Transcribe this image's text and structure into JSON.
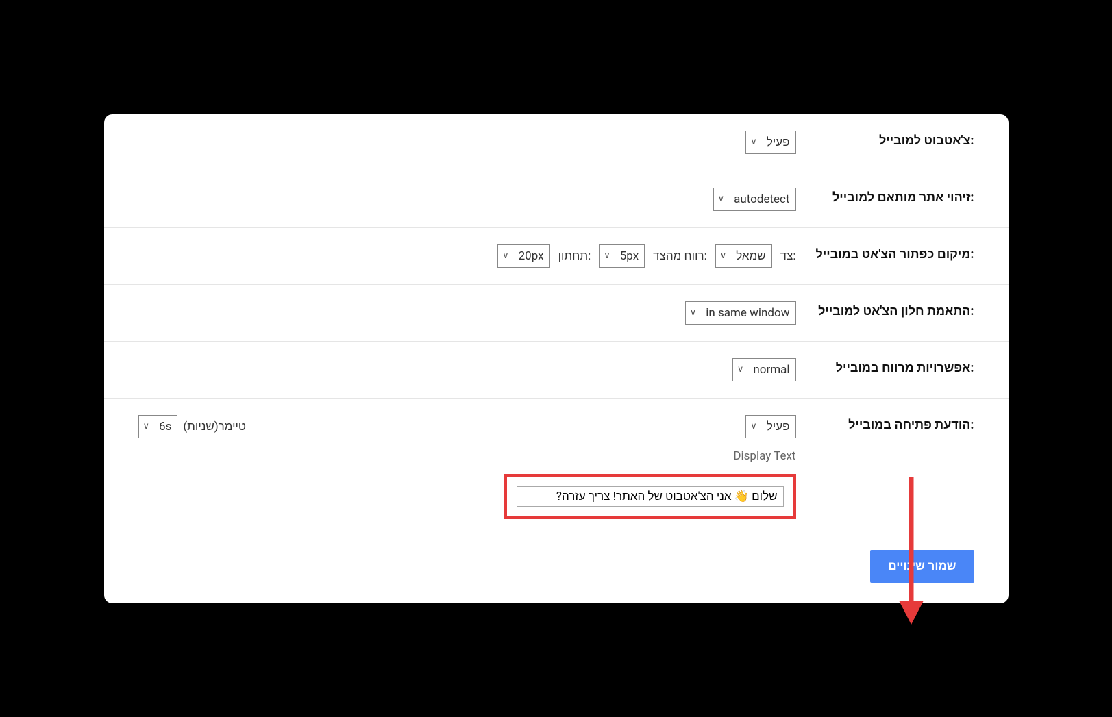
{
  "rows": {
    "chatbot_mobile": {
      "label": "צ'אטבוט למובייל:",
      "value": "פעיל"
    },
    "mobile_site_detect": {
      "label": "זיהוי אתר מותאם למובייל:",
      "value": "autodetect"
    },
    "button_position": {
      "label": "מיקום כפתור הצ'אט במובייל:",
      "side_label": "צד:",
      "side_value": "שמאל",
      "margin_label": "רווח מהצד:",
      "margin_value": "5px",
      "bottom_label": "תחתון:",
      "bottom_value": "20px"
    },
    "chat_window_fit": {
      "label": "התאמת חלון הצ'אט למובייל:",
      "value": "in same window"
    },
    "spacing_options": {
      "label": "אפשרויות מרווח במובייל:",
      "value": "normal"
    },
    "opening_message": {
      "label": "הודעת פתיחה במובייל:",
      "active_value": "פעיל",
      "timer_label": "טיימר(שניות)",
      "timer_value": "6s",
      "display_text_label": "Display Text",
      "display_text_value": "שלום 👋 אני הצ'אטבוט של האתר! צריך עזרה?"
    }
  },
  "footer": {
    "save_label": "שמור שינויים"
  },
  "colors": {
    "highlight": "#e63a3a",
    "primary_button": "#4a86f7"
  }
}
